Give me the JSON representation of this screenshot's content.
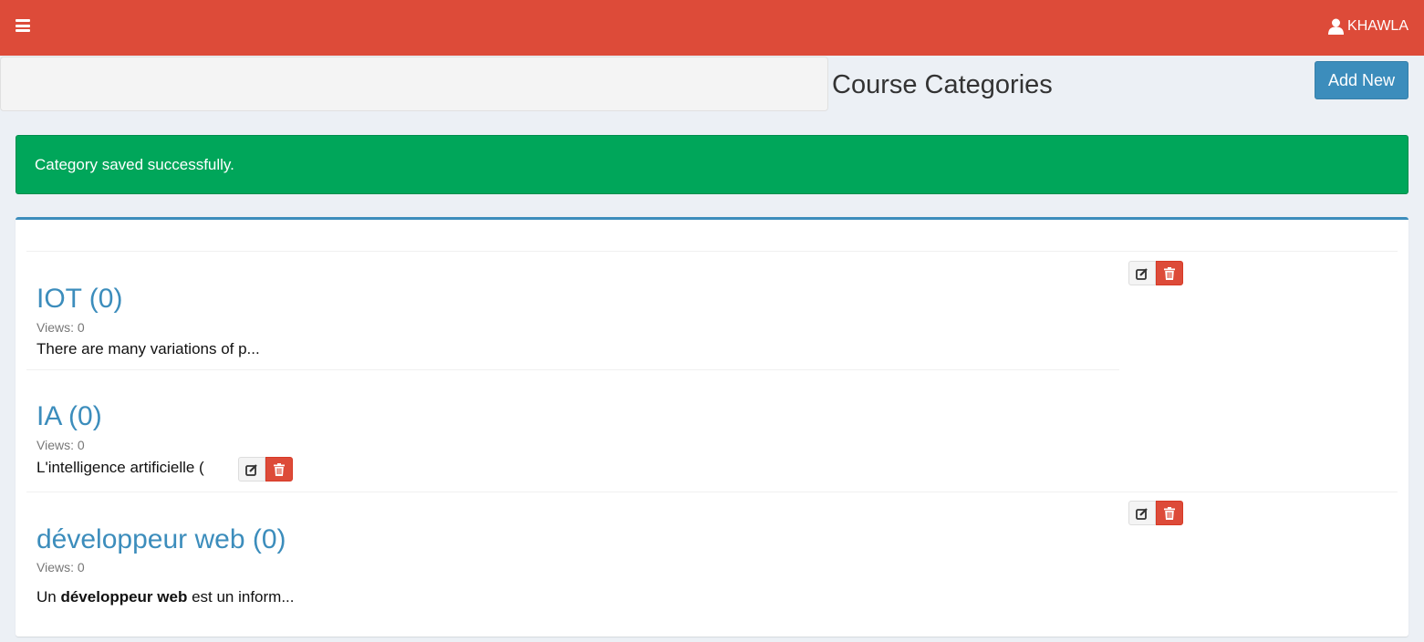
{
  "header": {
    "menu_icon": "hamburger-menu-icon",
    "user_icon": "user-icon",
    "user_name": "KHAWLA",
    "bar_color": "#dd4b39"
  },
  "page": {
    "title": "Course Categories",
    "add_button_label": "Add New"
  },
  "alert": {
    "message": "Category saved successfully.",
    "color": "#00a65a"
  },
  "categories": [
    {
      "title": "IOT (0)",
      "views": "Views: 0",
      "description": "There are many variations of p..."
    },
    {
      "title": "IA (0)",
      "views": "Views: 0",
      "description": "L'intelligence artificielle ("
    },
    {
      "title": "développeur web (0)",
      "views": "Views: 0",
      "description_prefix": "Un ",
      "description_bold": "développeur web",
      "description_suffix": " est un inform..."
    }
  ],
  "icons": {
    "edit": "edit-icon",
    "delete": "trash-icon"
  },
  "accent_color": "#3c8dbc"
}
